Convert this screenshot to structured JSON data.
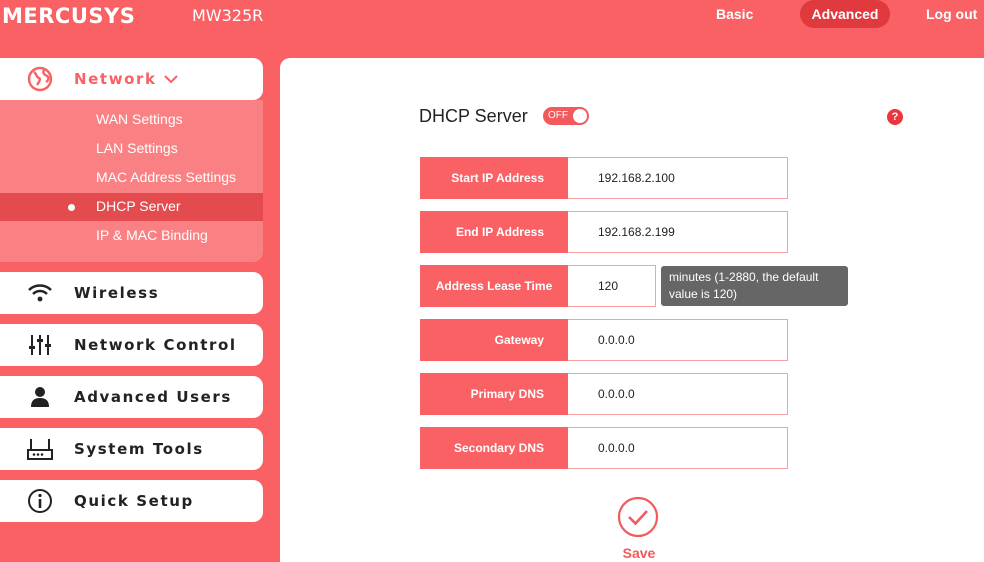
{
  "header": {
    "brand": "MERCUSYS",
    "model": "MW325R",
    "nav": {
      "basic": "Basic",
      "advanced": "Advanced",
      "logout": "Log out"
    }
  },
  "sidebar": {
    "network": {
      "label": "Network",
      "icon": "globe-icon",
      "submenu": [
        "WAN Settings",
        "LAN Settings",
        "MAC Address Settings",
        "DHCP Server",
        "IP & MAC Binding"
      ],
      "active": "DHCP Server"
    },
    "items": [
      {
        "label": "Wireless",
        "icon": "wifi-icon"
      },
      {
        "label": "Network Control",
        "icon": "sliders-icon"
      },
      {
        "label": "Advanced Users",
        "icon": "user-icon"
      },
      {
        "label": "System Tools",
        "icon": "router-icon"
      },
      {
        "label": "Quick Setup",
        "icon": "info-icon"
      }
    ]
  },
  "main": {
    "title": "DHCP Server",
    "toggle_text": "OFF",
    "help": "?",
    "fields": {
      "start_ip": {
        "label": "Start IP Address",
        "value": "192.168.2.100"
      },
      "end_ip": {
        "label": "End IP Address",
        "value": "192.168.2.199"
      },
      "lease": {
        "label": "Address Lease Time",
        "value": "120"
      },
      "gateway": {
        "label": "Gateway",
        "value": "0.0.0.0"
      },
      "primary_dns": {
        "label": "Primary DNS",
        "value": "0.0.0.0"
      },
      "secondary_dns": {
        "label": "Secondary DNS",
        "value": "0.0.0.0"
      }
    },
    "lease_tooltip": "minutes (1-2880, the default value is 120)",
    "save_label": "Save"
  },
  "colors": {
    "accent": "#f96164",
    "panel": "#ffffff",
    "tooltip": "#666666"
  }
}
